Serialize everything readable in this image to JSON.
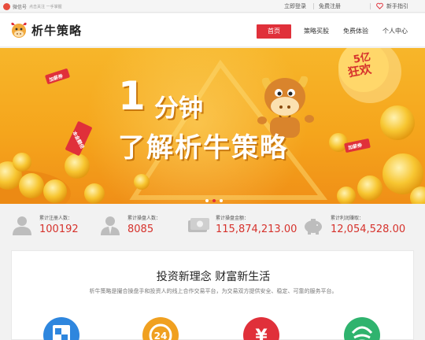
{
  "topbar": {
    "wechat_label": "微信号",
    "wechat_tip": "点击关注 一手掌握",
    "login": "立即登录",
    "register": "免费注册",
    "guide": "新手指引"
  },
  "header": {
    "logo_text": "析牛策略",
    "nav": [
      {
        "label": "首页",
        "active": true
      },
      {
        "label": "策略买股",
        "active": false
      },
      {
        "label": "免费体验",
        "active": false
      },
      {
        "label": "个人中心",
        "active": false
      }
    ]
  },
  "banner": {
    "headline_num": "1",
    "headline_top": "分钟",
    "headline_main": "了解析牛策略",
    "badge": [
      "5亿",
      "狂欢"
    ],
    "tags": [
      "加薪券",
      "加薪券",
      "本金翻倍"
    ],
    "colors": {
      "accent": "#e0303a",
      "banner": "#f5a51c"
    }
  },
  "stats": [
    {
      "label": "累计注册人数：",
      "value": "100192",
      "icon": "user-icon"
    },
    {
      "label": "累计操盘人数：",
      "value": "8085",
      "icon": "trader-icon"
    },
    {
      "label": "累计操盘金额：",
      "value": "115,874,213.00",
      "icon": "money-icon"
    },
    {
      "label": "累计利润赚取：",
      "value": "12,054,528.00",
      "icon": "piggy-bank-icon"
    }
  ],
  "content": {
    "slogan": "投资新理念  财富新生活",
    "intro": "析牛策略是撮合操盘手和投资人的线上合作交易平台，为交易双方提供安全、稳定、可靠的服务平台。",
    "features": [
      {
        "icon": "security-icon",
        "color": "#2e86de"
      },
      {
        "icon": "24h-icon",
        "color": "#f0a020"
      },
      {
        "icon": "yuan-icon",
        "color": "#e0303a"
      },
      {
        "icon": "service-icon",
        "color": "#2fb36e"
      }
    ]
  }
}
